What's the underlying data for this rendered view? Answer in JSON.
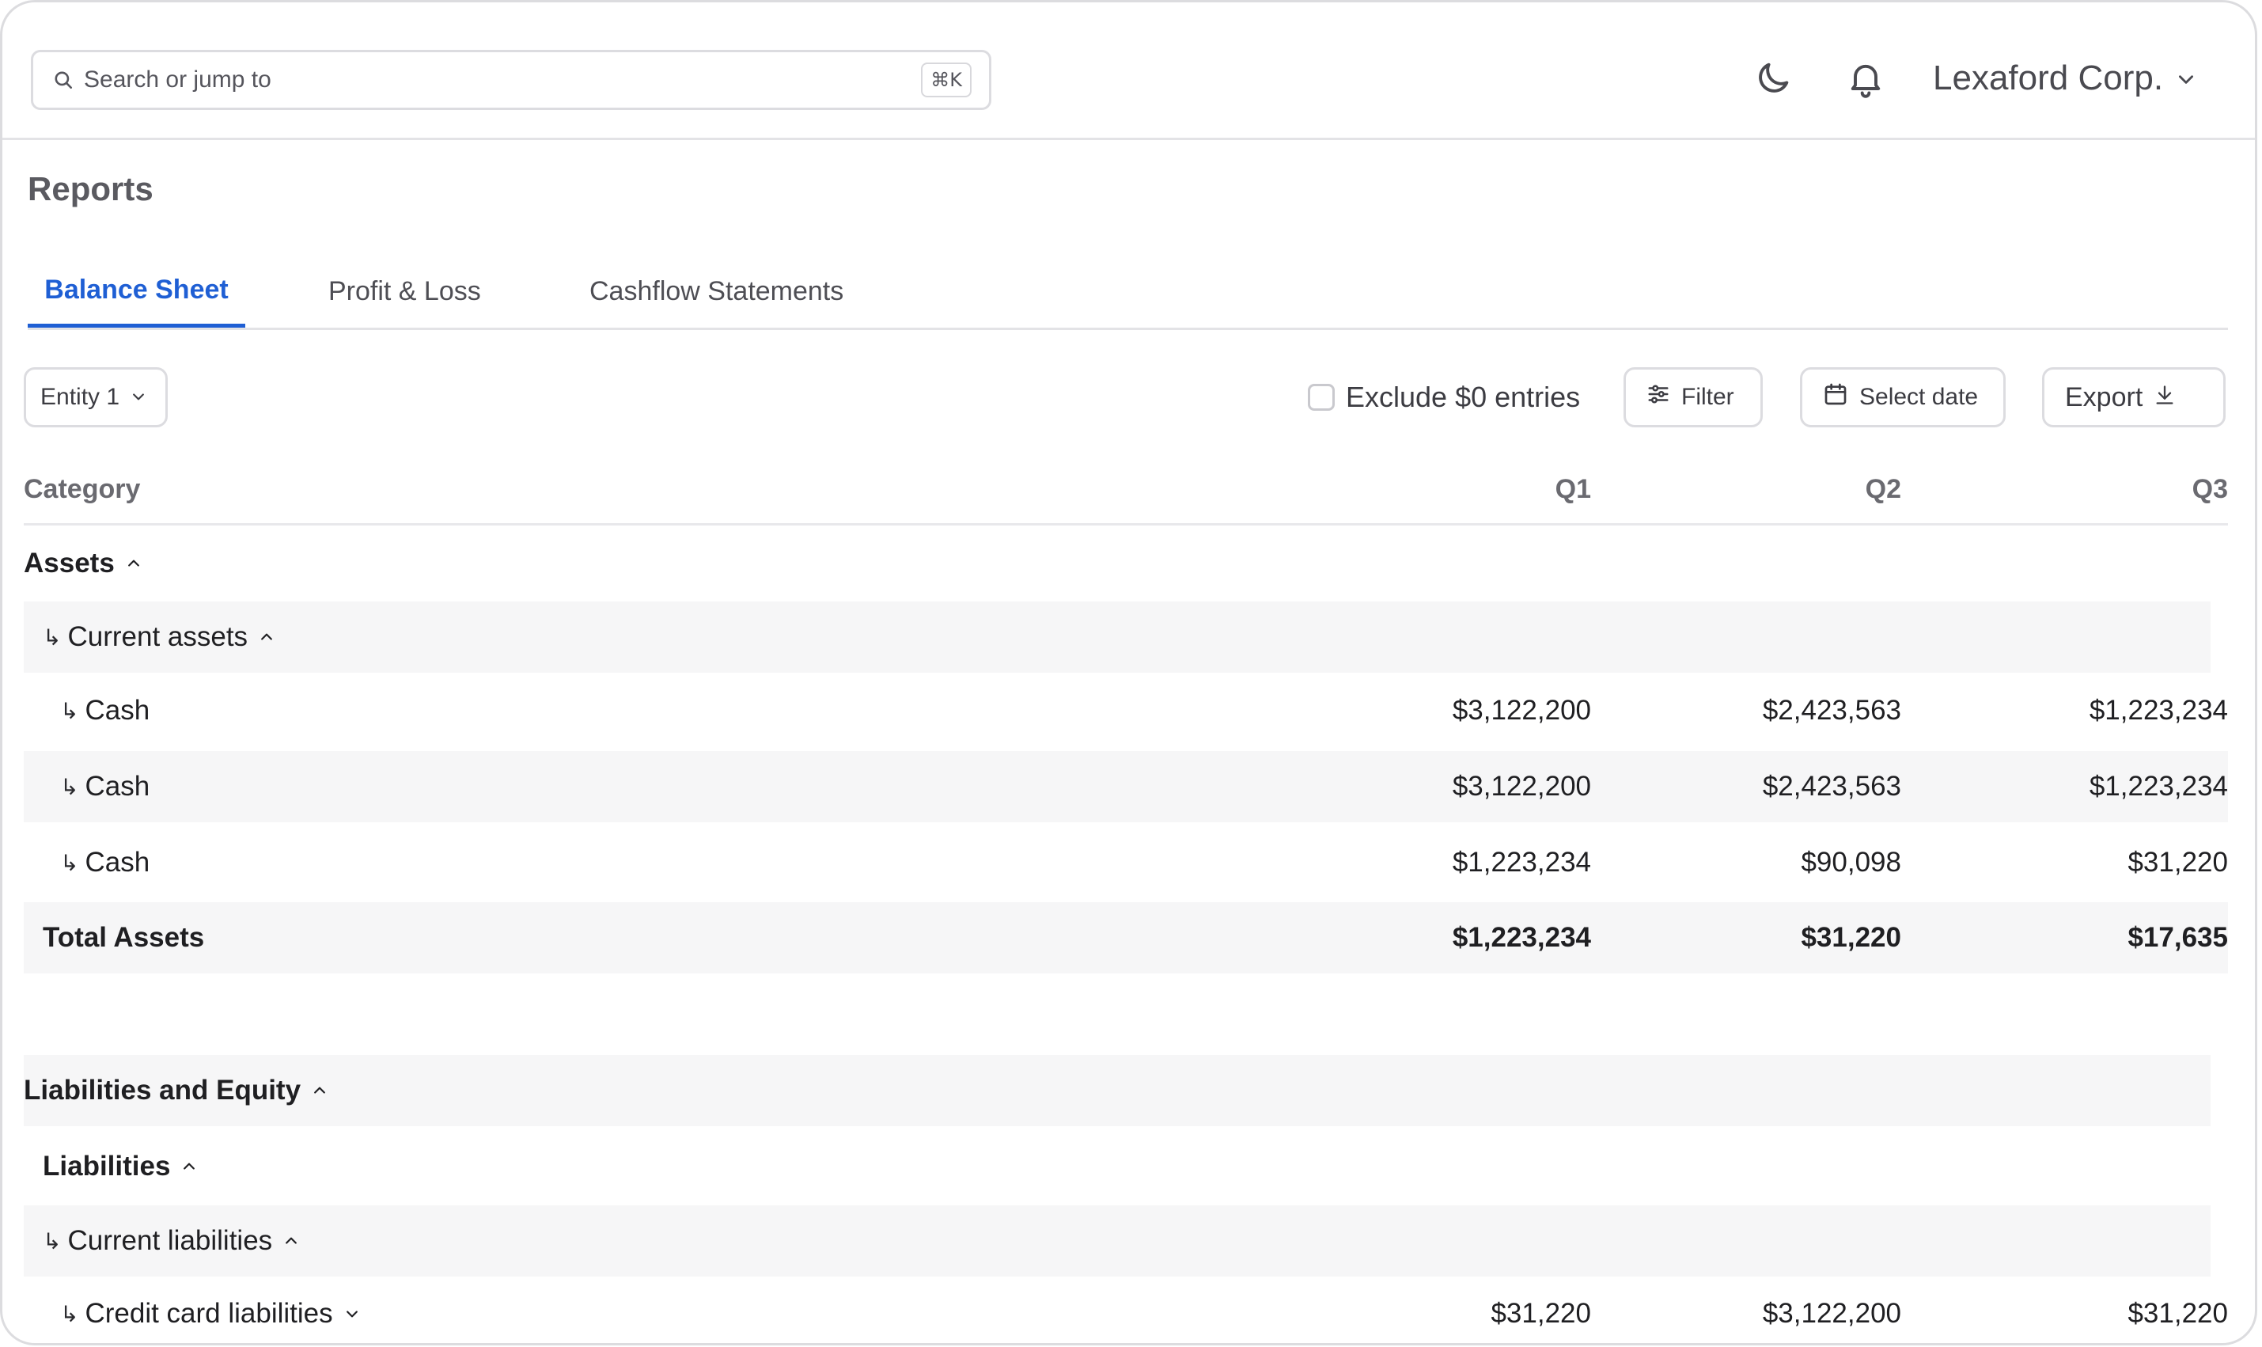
{
  "header": {
    "search_placeholder": "Search or jump to",
    "search_shortcut": "⌘K",
    "org_name": "Lexaford Corp."
  },
  "page": {
    "title": "Reports"
  },
  "tabs": [
    {
      "label": "Balance Sheet",
      "active": true
    },
    {
      "label": "Profit & Loss",
      "active": false
    },
    {
      "label": "Cashflow Statements",
      "active": false
    }
  ],
  "toolbar": {
    "entity": "Entity 1",
    "exclude_label": "Exclude $0 entries",
    "exclude_checked": false,
    "filter": "Filter",
    "select_date": "Select date",
    "export": "Export"
  },
  "table": {
    "columns": [
      "Category",
      "Q1",
      "Q2",
      "Q3"
    ],
    "rows": [
      {
        "label": "Assets",
        "q1": "",
        "q2": "",
        "q3": ""
      },
      {
        "label": "Current assets",
        "q1": "",
        "q2": "",
        "q3": ""
      },
      {
        "label": "Cash",
        "q1": "$3,122,200",
        "q2": "$2,423,563",
        "q3": "$1,223,234"
      },
      {
        "label": "Cash",
        "q1": "$3,122,200",
        "q2": "$2,423,563",
        "q3": "$1,223,234"
      },
      {
        "label": "Cash",
        "q1": "$1,223,234",
        "q2": "$90,098",
        "q3": "$31,220"
      },
      {
        "label": "Total Assets",
        "q1": "$1,223,234",
        "q2": "$31,220",
        "q3": "$17,635"
      },
      {
        "label": "Liabilities and Equity",
        "q1": "",
        "q2": "",
        "q3": ""
      },
      {
        "label": "Liabilities",
        "q1": "",
        "q2": "",
        "q3": ""
      },
      {
        "label": "Current liabilities",
        "q1": "",
        "q2": "",
        "q3": ""
      },
      {
        "label": "Credit card liabilities",
        "q1": "$31,220",
        "q2": "$3,122,200",
        "q3": "$31,220"
      }
    ]
  },
  "icons": {
    "search": "search-icon",
    "theme": "moon-icon",
    "notifications": "bell-icon",
    "org_menu": "chevron-down-icon",
    "filter": "sliders-icon",
    "date": "calendar-icon",
    "export": "download-icon",
    "sub_row": "return-arrow-icon"
  },
  "colors": {
    "accent": "#1f5fd4",
    "row_shade": "#f6f6f7",
    "border": "#dcdce0"
  }
}
